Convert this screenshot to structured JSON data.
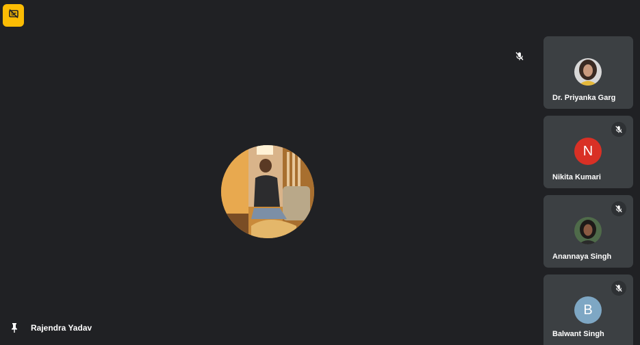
{
  "window": {
    "captions_badge_icon": "captions-off-icon",
    "captions_badge_color": "#fbbc04"
  },
  "main_view": {
    "presenter_name": "Rajendra Yadav",
    "pin_icon": "pin-icon",
    "mute_icon": "mic-off-icon"
  },
  "participants": [
    {
      "name": "Dr. Priyanka Garg",
      "avatar_type": "photo",
      "muted_indicator": false
    },
    {
      "name": "Nikita Kumari",
      "avatar_type": "initial",
      "initial": "N",
      "avatar_color": "#d93025",
      "muted_indicator": true
    },
    {
      "name": "Anannaya Singh",
      "avatar_type": "photo",
      "muted_indicator": true
    },
    {
      "name": "Balwant Singh",
      "avatar_type": "initial",
      "initial": "B",
      "avatar_color": "#7ea7c4",
      "muted_indicator": true
    }
  ],
  "colors": {
    "background": "#202124",
    "tile": "#3c4043"
  }
}
